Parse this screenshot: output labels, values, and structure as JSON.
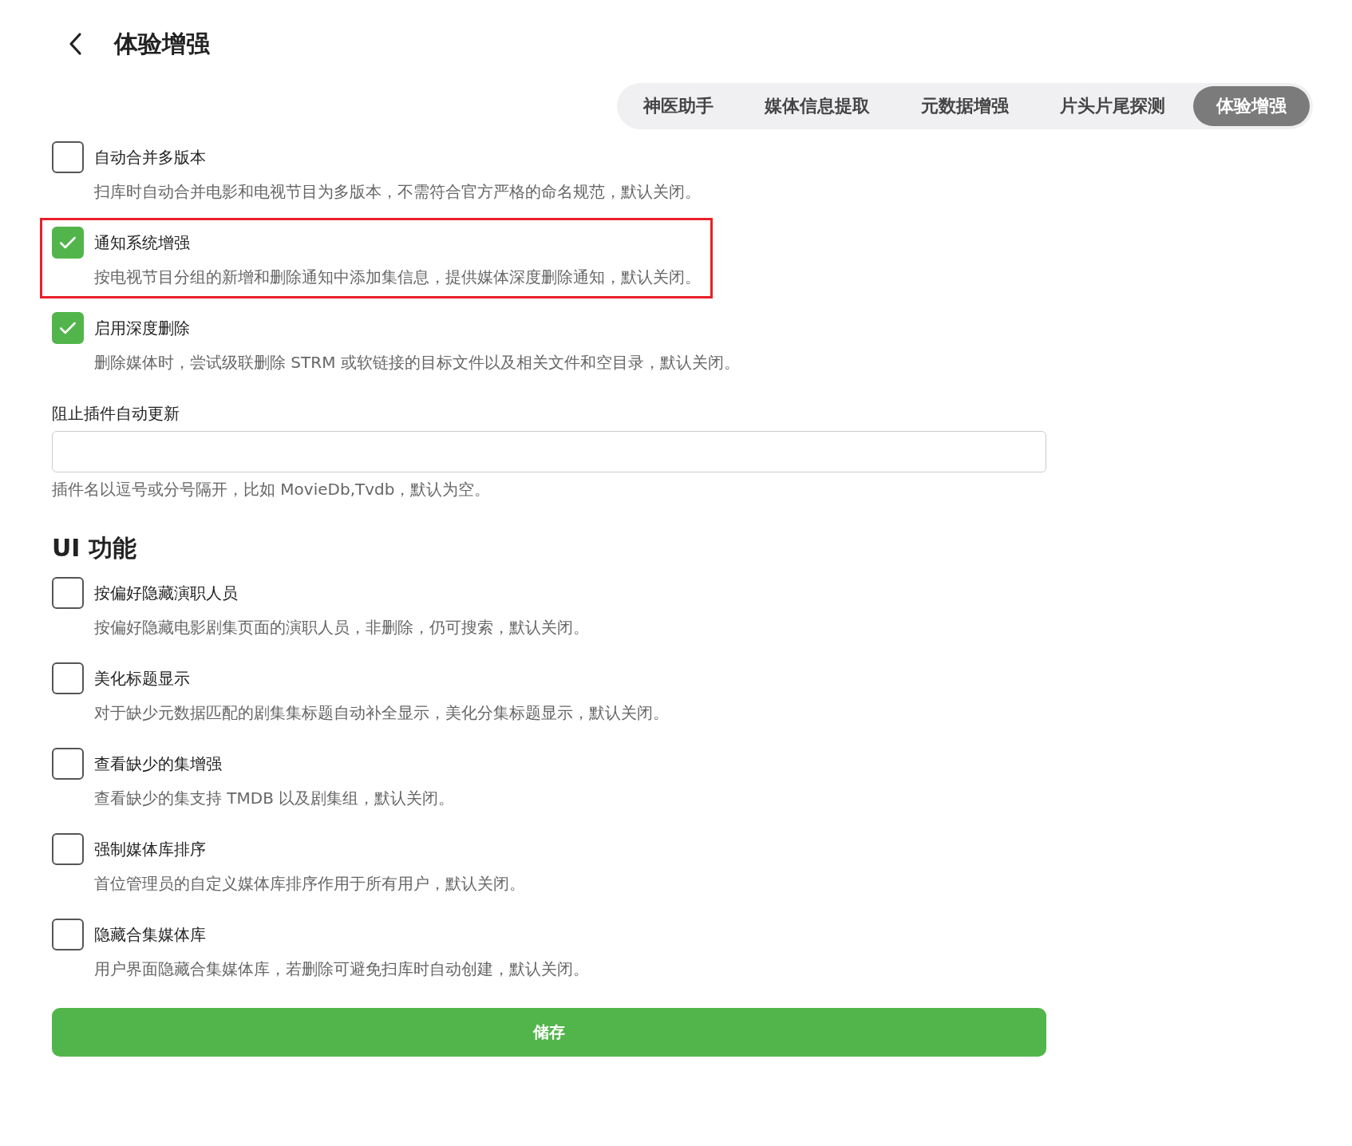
{
  "header": {
    "title": "体验增强"
  },
  "tabs": [
    {
      "label": "神医助手",
      "selected": false
    },
    {
      "label": "媒体信息提取",
      "selected": false
    },
    {
      "label": "元数据增强",
      "selected": false
    },
    {
      "label": "片头片尾探测",
      "selected": false
    },
    {
      "label": "体验增强",
      "selected": true
    }
  ],
  "settings": [
    {
      "label": "自动合并多版本",
      "description": "扫库时自动合并电影和电视节目为多版本，不需符合官方严格的命名规范，默认关闭。",
      "checked": false,
      "highlighted": false
    },
    {
      "label": "通知系统增强",
      "description": "按电视节目分组的新增和删除通知中添加集信息，提供媒体深度删除通知，默认关闭。",
      "checked": true,
      "highlighted": true
    },
    {
      "label": "启用深度删除",
      "description": "删除媒体时，尝试级联删除 STRM 或软链接的目标文件以及相关文件和空目录，默认关闭。",
      "checked": true,
      "highlighted": false
    }
  ],
  "plugin_field": {
    "label": "阻止插件自动更新",
    "hint": "插件名以逗号或分号隔开，比如 MovieDb,Tvdb，默认为空。"
  },
  "ui_section": {
    "title": "UI 功能",
    "settings": [
      {
        "label": "按偏好隐藏演职人员",
        "description": "按偏好隐藏电影剧集页面的演职人员，非删除，仍可搜索，默认关闭。",
        "checked": false,
        "highlighted": false
      },
      {
        "label": "美化标题显示",
        "description": "对于缺少元数据匹配的剧集集标题自动补全显示，美化分集标题显示，默认关闭。",
        "checked": false,
        "highlighted": false
      },
      {
        "label": "查看缺少的集增强",
        "description": "查看缺少的集支持 TMDB 以及剧集组，默认关闭。",
        "checked": false,
        "highlighted": false
      },
      {
        "label": "强制媒体库排序",
        "description": "首位管理员的自定义媒体库排序作用于所有用户，默认关闭。",
        "checked": false,
        "highlighted": false
      },
      {
        "label": "隐藏合集媒体库",
        "description": "用户界面隐藏合集媒体库，若删除可避免扫库时自动创建，默认关闭。",
        "checked": false,
        "highlighted": false
      }
    ]
  },
  "save_button": {
    "label": "储存"
  }
}
